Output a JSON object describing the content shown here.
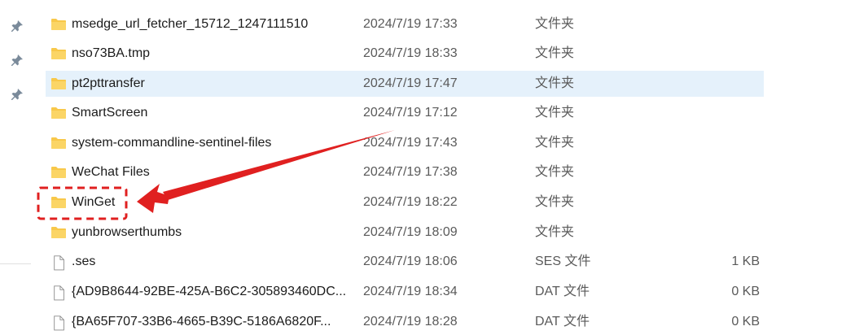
{
  "rows": [
    {
      "name": "msedge_url_fetcher_15712_1247111510",
      "date": "2024/7/19 17:33",
      "type": "文件夹",
      "size": "",
      "kind": "folder"
    },
    {
      "name": "nso73BA.tmp",
      "date": "2024/7/19 18:33",
      "type": "文件夹",
      "size": "",
      "kind": "folder"
    },
    {
      "name": "pt2pttransfer",
      "date": "2024/7/19 17:47",
      "type": "文件夹",
      "size": "",
      "kind": "folder",
      "selected": true
    },
    {
      "name": "SmartScreen",
      "date": "2024/7/19 17:12",
      "type": "文件夹",
      "size": "",
      "kind": "folder"
    },
    {
      "name": "system-commandline-sentinel-files",
      "date": "2024/7/19 17:43",
      "type": "文件夹",
      "size": "",
      "kind": "folder"
    },
    {
      "name": "WeChat Files",
      "date": "2024/7/19 17:38",
      "type": "文件夹",
      "size": "",
      "kind": "folder"
    },
    {
      "name": "WinGet",
      "date": "2024/7/19 18:22",
      "type": "文件夹",
      "size": "",
      "kind": "folder",
      "highlighted": true
    },
    {
      "name": "yunbrowserthumbs",
      "date": "2024/7/19 18:09",
      "type": "文件夹",
      "size": "",
      "kind": "folder"
    },
    {
      "name": ".ses",
      "date": "2024/7/19 18:06",
      "type": "SES 文件",
      "size": "1 KB",
      "kind": "file"
    },
    {
      "name": "{AD9B8644-92BE-425A-B6C2-305893460DC...",
      "date": "2024/7/19 18:34",
      "type": "DAT 文件",
      "size": "0 KB",
      "kind": "file"
    },
    {
      "name": "{BA65F707-33B6-4665-B39C-5186A6820F...",
      "date": "2024/7/19 18:28",
      "type": "DAT 文件",
      "size": "0 KB",
      "kind": "file"
    }
  ],
  "colors": {
    "folder": "#f8c84a",
    "folder_dark": "#e6a92b",
    "selection": "#e5f1fb",
    "annotation": "#e02020"
  },
  "icons": {
    "pin": "pin-icon",
    "folder": "folder-icon",
    "file": "file-icon"
  }
}
